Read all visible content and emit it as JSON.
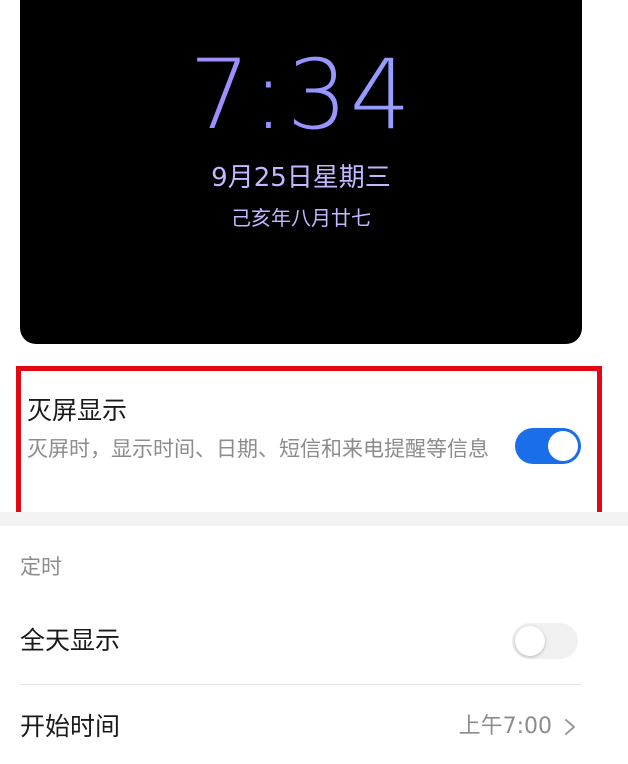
{
  "preview": {
    "time": "7:34",
    "date": "9月25日星期三",
    "lunar_date": "己亥年八月廿七"
  },
  "aod": {
    "title": "灭屏显示",
    "description": "灭屏时，显示时间、日期、短信和来电提醒等信息",
    "enabled": true
  },
  "timing": {
    "header": "定时",
    "all_day": {
      "label": "全天显示",
      "enabled": false
    },
    "start_time": {
      "label": "开始时间",
      "value": "上午7:00"
    }
  },
  "colors": {
    "highlight_border": "#e30613",
    "toggle_on": "#1a6eea",
    "toggle_off": "#f0f0f0",
    "clock_gradient_start": "#b08cff",
    "clock_gradient_end": "#8fb6ff",
    "secondary_text": "#8c8c8c"
  },
  "icons": {
    "chevron": "chevron-right-icon"
  }
}
